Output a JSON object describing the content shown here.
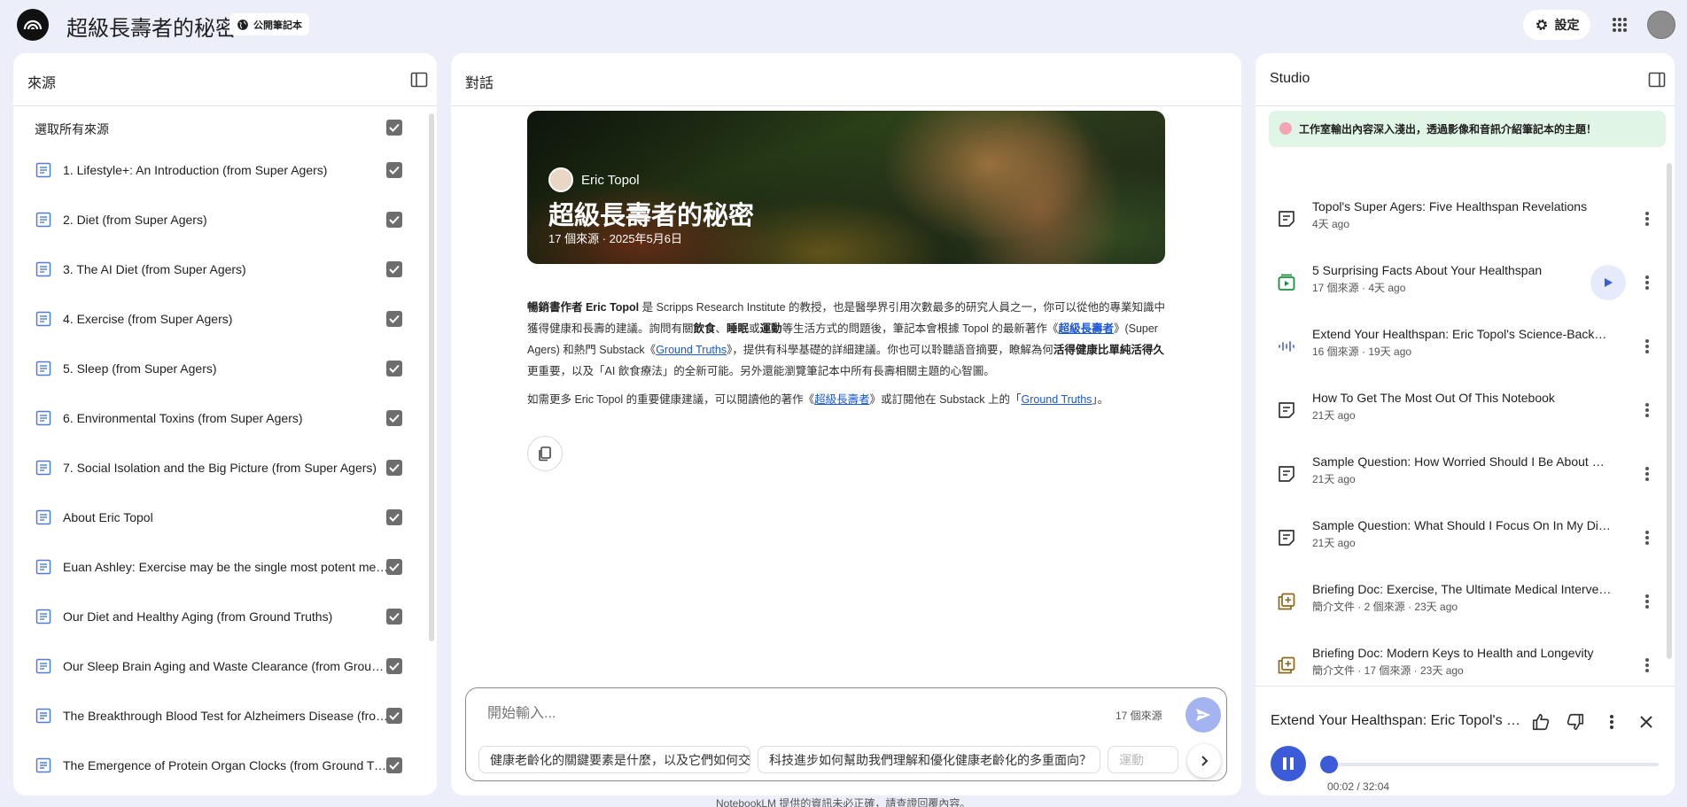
{
  "header": {
    "notebook_title": "超級長壽者的秘密",
    "public_chip": "公開筆記本",
    "settings_label": "設定"
  },
  "sources": {
    "panel_title": "來源",
    "select_all": "選取所有來源",
    "items": [
      {
        "label": "1. Lifestyle+: An Introduction (from Super Agers)",
        "checked": true
      },
      {
        "label": "2. Diet (from Super Agers)",
        "checked": true
      },
      {
        "label": "3. The AI Diet (from Super Agers)",
        "checked": true
      },
      {
        "label": "4. Exercise (from Super Agers)",
        "checked": true
      },
      {
        "label": "5. Sleep (from Super Agers)",
        "checked": true
      },
      {
        "label": "6. Environmental Toxins (from Super Agers)",
        "checked": true
      },
      {
        "label": "7. Social Isolation and the Big Picture (from Super Agers)",
        "checked": true
      },
      {
        "label": "About Eric Topol",
        "checked": true
      },
      {
        "label": "Euan Ashley: Exercise may be the single most potent medicine",
        "checked": true
      },
      {
        "label": "Our Diet and Healthy Aging (from Ground Truths)",
        "checked": true
      },
      {
        "label": "Our Sleep Brain Aging and Waste Clearance (from Ground Truths)",
        "checked": true
      },
      {
        "label": "The Breakthrough Blood Test for Alzheimers Disease (from Ground Truths)",
        "checked": true
      },
      {
        "label": "The Emergence of Protein Organ Clocks (from Ground Truths)",
        "checked": true
      }
    ]
  },
  "chat": {
    "panel_title": "對話",
    "hero": {
      "author": "Eric Topol",
      "title": "超級長壽者的秘密",
      "meta": "17 個來源 · 2025年5月6日"
    },
    "summary": {
      "p1": [
        {
          "t": "暢銷書作者 Eric Topol",
          "b": true
        },
        {
          "t": " 是 Scripps Research Institute 的教授，也是醫學界引用次數最多的研究人員之一，你可以從他的專業知識中獲得健康和長壽的建議。詢問有關"
        },
        {
          "t": "飲食",
          "b": true
        },
        {
          "t": "、"
        },
        {
          "t": "睡眠",
          "b": true
        },
        {
          "t": "或"
        },
        {
          "t": "運動",
          "b": true
        },
        {
          "t": "等生活方式的問題後，筆記本會根據 Topol 的最新著作《"
        },
        {
          "t": "超級長壽者",
          "link": true,
          "b": true
        },
        {
          "t": "》(Super Agers) 和熱門 Substack《"
        },
        {
          "t": "Ground Truths",
          "link": true
        },
        {
          "t": "》，提供有科學基礎的詳細建議。你也可以聆聽語音摘要，瞭解為何"
        },
        {
          "t": "活得健康比單純活得久",
          "b": true
        },
        {
          "t": "更重要，以及「AI 飲食療法」的全新可能。另外還能瀏覽筆記本中所有長壽相關主題的心智圖。"
        }
      ],
      "p2": [
        {
          "t": "如需更多 Eric Topol 的重要健康建議，可以閱讀他的著作《"
        },
        {
          "t": "超級長壽者",
          "link": true
        },
        {
          "t": "》或訂閱他在 Substack 上的「"
        },
        {
          "t": "Ground Truths",
          "link": true
        },
        {
          "t": "」。"
        }
      ]
    },
    "composer": {
      "placeholder": "開始輸入...",
      "source_count": "17 個來源"
    },
    "suggestions": [
      "健康老齡化的關鍵要素是什麼，以及它們如何交互影響？",
      "科技進步如何幫助我們理解和優化健康老齡化的多重面向？",
      "運動"
    ]
  },
  "studio": {
    "panel_title": "Studio",
    "banner": "工作室輸出內容深入淺出，透過影像和音訊介紹筆記本的主題！",
    "notes": [
      {
        "icon": "note-icon",
        "title": "Topol's Super Agers: Five Healthspan Revelations",
        "meta": "4天 ago"
      },
      {
        "icon": "video-overview-icon",
        "title": "5 Surprising Facts About Your Healthspan",
        "meta": "17 個來源 · 4天 ago",
        "playable": true
      },
      {
        "icon": "audio-overview-icon",
        "title": "Extend Your Healthspan: Eric Topol's Science-Backed Guide",
        "meta": "16 個來源 · 19天 ago"
      },
      {
        "icon": "note-icon",
        "title": "How To Get The Most Out Of This Notebook",
        "meta": "21天 ago"
      },
      {
        "icon": "note-icon",
        "title": "Sample Question: How Worried Should I Be About Microplastics?",
        "meta": "21天 ago"
      },
      {
        "icon": "note-icon",
        "title": "Sample Question: What Should I Focus On In My Diet?",
        "meta": "21天 ago"
      },
      {
        "icon": "briefing-doc-icon",
        "title": "Briefing Doc: Exercise, The Ultimate Medical Intervention",
        "meta": "簡介文件 · 2 個來源 · 23天 ago"
      },
      {
        "icon": "briefing-doc-icon",
        "title": "Briefing Doc: Modern Keys to Health and Longevity",
        "meta": "簡介文件 · 17 個來源 · 23天 ago"
      }
    ],
    "player": {
      "title": "Extend Your Healthspan: Eric Topol's Science-Backed Guide",
      "time": "00:02 / 32:04",
      "progress": 0.001
    }
  },
  "footer": {
    "disclaimer": "NotebookLM 提供的資訊未必正確，請查證回覆內容。"
  },
  "colors": {
    "background": "#eceefa",
    "accent": "#3c5bd9",
    "banner": "#e0f5e6"
  }
}
